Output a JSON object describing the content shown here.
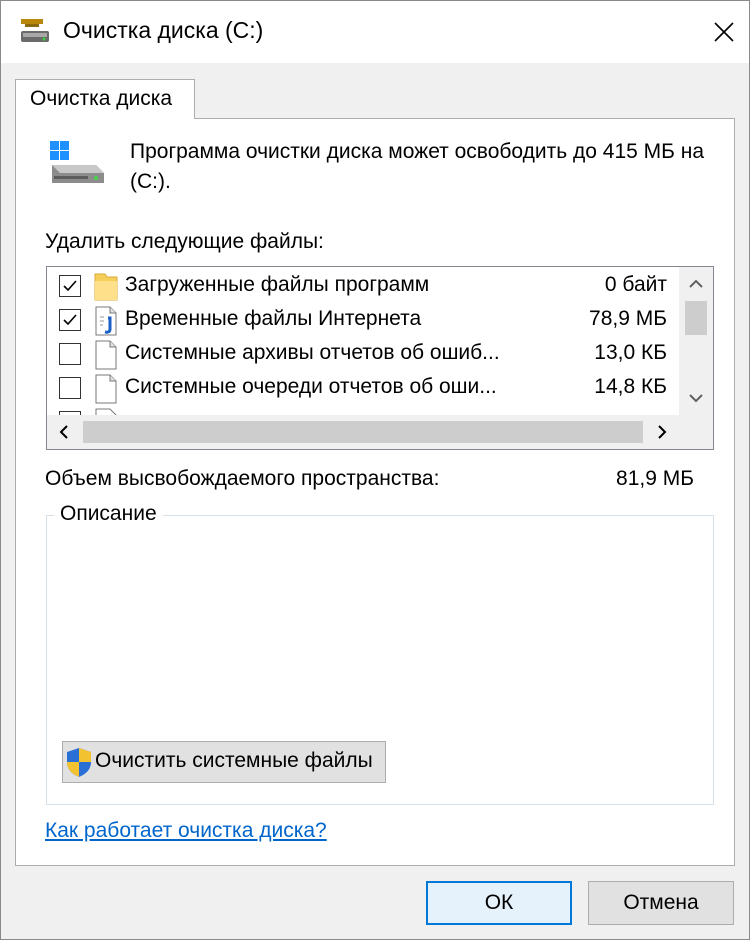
{
  "window": {
    "title": "Очистка диска  (C:)"
  },
  "tab": {
    "label": "Очистка диска"
  },
  "intro": {
    "text": "Программа очистки диска может освободить до 415 МБ на  (C:)."
  },
  "files_section": {
    "label": "Удалить следующие файлы:",
    "items": [
      {
        "checked": true,
        "icon": "folder-icon",
        "name": "Загруженные файлы программ",
        "size": "0 байт"
      },
      {
        "checked": true,
        "icon": "internet-file-icon",
        "name": "Временные файлы Интернета",
        "size": "78,9 МБ"
      },
      {
        "checked": false,
        "icon": "document-icon",
        "name": "Системные архивы отчетов об ошиб...",
        "size": "13,0 КБ"
      },
      {
        "checked": false,
        "icon": "document-icon",
        "name": "Системные очереди отчетов об оши...",
        "size": "14,8 КБ"
      }
    ]
  },
  "space": {
    "label": "Объем высвобождаемого пространства:",
    "value": "81,9 МБ"
  },
  "description": {
    "legend": "Описание"
  },
  "system_files_button": {
    "label": "Очистить системные файлы"
  },
  "help_link": {
    "text": "Как работает очистка диска?"
  },
  "buttons": {
    "ok": "ОК",
    "cancel": "Отмена"
  },
  "colors": {
    "accent": "#0078d7",
    "link": "#0066cc",
    "dialog_bg": "#f0f0f0"
  }
}
